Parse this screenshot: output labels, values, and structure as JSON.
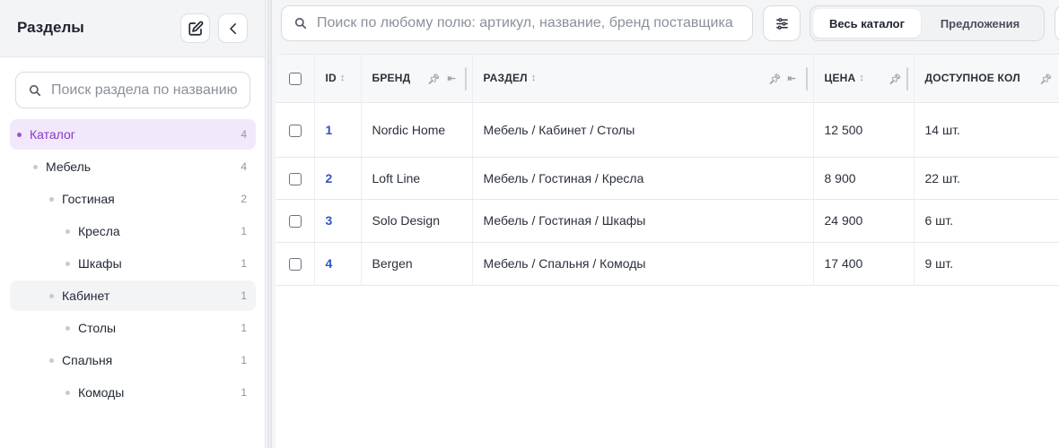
{
  "sidebar": {
    "title": "Разделы",
    "search_placeholder": "Поиск раздела по названию",
    "tree": [
      {
        "label": "Каталог",
        "count": "4",
        "level": 0,
        "state": "selected"
      },
      {
        "label": "Мебель",
        "count": "4",
        "level": 1,
        "state": ""
      },
      {
        "label": "Гостиная",
        "count": "2",
        "level": 2,
        "state": ""
      },
      {
        "label": "Кресла",
        "count": "1",
        "level": 3,
        "state": ""
      },
      {
        "label": "Шкафы",
        "count": "1",
        "level": 3,
        "state": ""
      },
      {
        "label": "Кабинет",
        "count": "1",
        "level": 2,
        "state": "hover"
      },
      {
        "label": "Столы",
        "count": "1",
        "level": 3,
        "state": ""
      },
      {
        "label": "Спальня",
        "count": "1",
        "level": 2,
        "state": ""
      },
      {
        "label": "Комоды",
        "count": "1",
        "level": 3,
        "state": ""
      }
    ]
  },
  "toolbar": {
    "search_placeholder": "Поиск по любому полю: артикул, название, бренд поставщика",
    "tabs": [
      {
        "label": "Весь каталог",
        "active": true
      },
      {
        "label": "Предложения",
        "active": false
      }
    ]
  },
  "table": {
    "headers": {
      "id": "ID",
      "brand": "БРЕНД",
      "section": "РАЗДЕЛ",
      "price": "ЦЕНА",
      "qty": "ДОСТУПНОЕ КОЛ"
    },
    "rows": [
      {
        "id": "1",
        "brand": "Nordic Home",
        "section": "Мебель / Кабинет / Столы",
        "price": "12 500",
        "qty": "14 шт."
      },
      {
        "id": "2",
        "brand": "Loft Line",
        "section": "Мебель / Гостиная / Кресла",
        "price": "8 900",
        "qty": "22 шт."
      },
      {
        "id": "3",
        "brand": "Solo Design",
        "section": "Мебель / Гостиная / Шкафы",
        "price": "24 900",
        "qty": "6 шт."
      },
      {
        "id": "4",
        "brand": "Bergen",
        "section": "Мебель / Спальня / Комоды",
        "price": "17 400",
        "qty": "9 шт."
      }
    ]
  },
  "colors": {
    "accent": "#8a36c9",
    "selected_bg": "#f1e9fb",
    "link": "#2f55c6"
  }
}
